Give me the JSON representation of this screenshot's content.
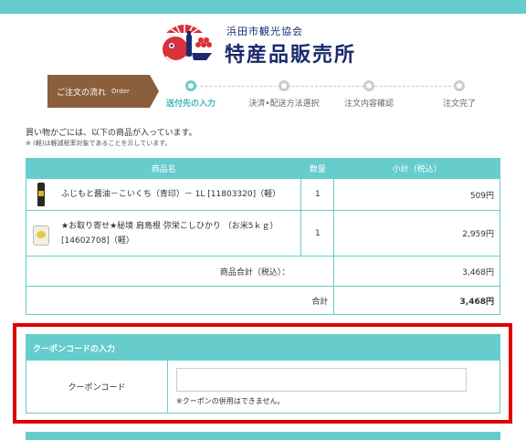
{
  "header": {
    "sub_title": "浜田市観光協会",
    "title": "特産品販売所"
  },
  "flow": {
    "label": "ご注文の流れ",
    "label_en": "Order",
    "steps": [
      {
        "label": "送付先の入力",
        "active": true
      },
      {
        "label": "決済•配送方法選択",
        "active": false
      },
      {
        "label": "注文内容確認",
        "active": false
      },
      {
        "label": "注文完了",
        "active": false
      }
    ]
  },
  "intro": "買い物かごには、以下の商品が入っています。",
  "note": "※ (軽)は軽減税率対象であることを示しています。",
  "cart": {
    "headers": {
      "name": "商品名",
      "qty": "数量",
      "subtotal": "小計（税込）"
    },
    "items": [
      {
        "name": "ふじもと醤油－こいくち（青印）－ 1L [11803320]（軽）",
        "qty": "1",
        "subtotal": "509円",
        "thumb": "soy-sauce-bottle"
      },
      {
        "name": "★お取り寄せ★秘境 肩島根 弥栄こしひかり （お米5ｋｇ）[14602708]（軽）",
        "qty": "1",
        "subtotal": "2,959円",
        "thumb": "rice-bag"
      }
    ],
    "items_total_label": "商品合計（税込）：",
    "items_total": "3,468円",
    "grand_total_label": "合計",
    "grand_total": "3,468円"
  },
  "coupon": {
    "heading": "クーポンコードの入力",
    "label": "クーポンコード",
    "value": "",
    "placeholder": "",
    "note": "※クーポンの併用はできません。"
  },
  "colors": {
    "accent": "#66cccc",
    "brand_brown": "#8b5e3c",
    "highlight": "#e00000",
    "total_red": "#e03030"
  }
}
